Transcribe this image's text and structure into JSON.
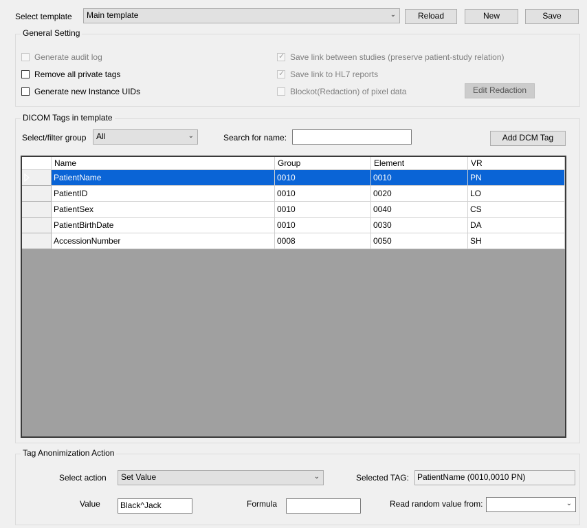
{
  "top": {
    "select_template_label": "Select template",
    "template_value": "Main template",
    "reload_label": "Reload",
    "new_label": "New",
    "save_label": "Save"
  },
  "general": {
    "legend": "General Setting",
    "audit_log": {
      "label": "Generate audit log",
      "checked": false,
      "enabled": false
    },
    "remove_private": {
      "label": "Remove all private tags",
      "checked": false,
      "enabled": true
    },
    "new_uids": {
      "label": "Generate new Instance UIDs",
      "checked": false,
      "enabled": true
    },
    "save_link_studies": {
      "label": "Save link between studies (preserve patient-study relation)",
      "checked": true,
      "enabled": false
    },
    "save_link_hl7": {
      "label": "Save link to HL7 reports",
      "checked": true,
      "enabled": false
    },
    "blockout": {
      "label": "Blockot(Redaction) of pixel data",
      "checked": false,
      "enabled": false
    },
    "edit_redaction_label": "Edit Redaction"
  },
  "tags": {
    "legend": "DICOM Tags in template",
    "filter_label": "Select/filter group",
    "filter_value": "All",
    "search_label": "Search for name:",
    "search_value": "",
    "add_label": "Add DCM Tag",
    "columns": [
      "Name",
      "Group",
      "Element",
      "VR"
    ],
    "rows": [
      [
        "PatientName",
        "0010",
        "0010",
        "PN"
      ],
      [
        "PatientID",
        "0010",
        "0020",
        "LO"
      ],
      [
        "PatientSex",
        "0010",
        "0040",
        "CS"
      ],
      [
        "PatientBirthDate",
        "0010",
        "0030",
        "DA"
      ],
      [
        "AccessionNumber",
        "0008",
        "0050",
        "SH"
      ]
    ],
    "selected_row": 0
  },
  "action": {
    "legend": "Tag Anonimization Action",
    "select_action_label": "Select action",
    "action_value": "Set Value",
    "selected_tag_label": "Selected TAG:",
    "selected_tag_value": "PatientName (0010,0010 PN)",
    "value_label": "Value",
    "value_value": "Black^Jack",
    "formula_label": "Formula",
    "formula_value": "",
    "random_label": "Read random value from:",
    "random_value": ""
  },
  "icons": {
    "dropdown": "chevron-down-icon",
    "row_pointer": "row-pointer-icon",
    "check": "check-icon"
  },
  "colors": {
    "selection": "#0a64d6",
    "grid_background": "#a0a0a0"
  }
}
